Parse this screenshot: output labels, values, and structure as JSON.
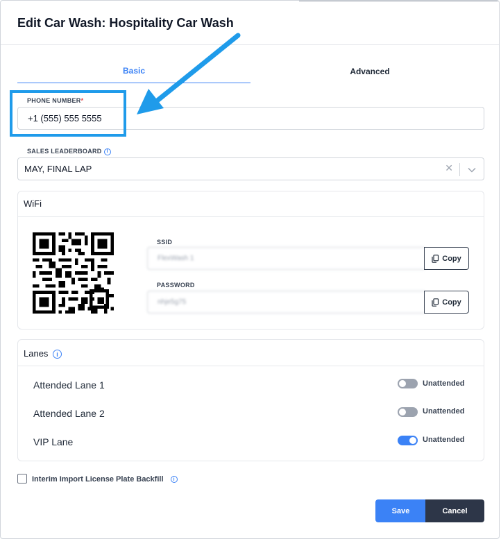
{
  "modal": {
    "title": "Edit Car Wash: Hospitality Car Wash"
  },
  "tabs": [
    {
      "label": "Basic",
      "active": true
    },
    {
      "label": "Advanced",
      "active": false
    }
  ],
  "phone": {
    "label": "PHONE NUMBER",
    "required_mark": "*",
    "value": "+1 (555) 555 5555"
  },
  "sales_leaderboard": {
    "label": "SALES LEADERBOARD",
    "info_icon": "info-icon",
    "selected": "MAY, FINAL LAP",
    "clear_glyph": "✕"
  },
  "wifi": {
    "title": "WiFi",
    "ssid": {
      "label": "SSID",
      "value": "FlexWash 1",
      "copy_label": "Copy"
    },
    "password": {
      "label": "PASSWORD",
      "value": "nhje5g75",
      "copy_label": "Copy"
    }
  },
  "lanes": {
    "title": "Lanes",
    "items": [
      {
        "name": "Attended Lane 1",
        "toggle_on": false,
        "toggle_label": "Unattended"
      },
      {
        "name": "Attended Lane 2",
        "toggle_on": false,
        "toggle_label": "Unattended"
      },
      {
        "name": "VIP Lane",
        "toggle_on": true,
        "toggle_label": "Unattended"
      }
    ]
  },
  "interim_import": {
    "label": "Interim Import License Plate Backfill",
    "checked": false
  },
  "actions": {
    "save_label": "Save",
    "cancel_label": "Cancel"
  },
  "colors": {
    "accent": "#3b82f6",
    "annotation": "#1f9bea",
    "cancel_bg": "#2d3648"
  }
}
